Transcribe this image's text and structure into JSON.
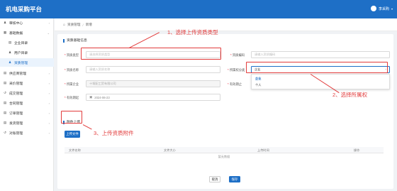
{
  "header": {
    "app_title": "机电采购平台",
    "user_name": "李采购",
    "caret": "▾"
  },
  "sidebar": {
    "items": [
      {
        "icon": "user-icon",
        "glyph": "♟",
        "label": "审核中心",
        "arrow": "›"
      },
      {
        "icon": "database-icon",
        "glyph": "▦",
        "label": "基础数据",
        "arrow": "⌄"
      },
      {
        "icon": "building-icon",
        "glyph": "▤",
        "label": "企业目录"
      },
      {
        "icon": "users-icon",
        "glyph": "♟",
        "label": "用户目录"
      },
      {
        "icon": "qualification-icon",
        "glyph": "♟",
        "label": "资质管理"
      },
      {
        "icon": "supplier-icon",
        "glyph": "▤",
        "label": "供应商管理",
        "arrow": "›"
      },
      {
        "icon": "inquiry-icon",
        "glyph": "▤",
        "label": "采价管理",
        "arrow": "›"
      },
      {
        "icon": "deal-icon",
        "glyph": "↺",
        "label": "成交管理",
        "arrow": "›"
      },
      {
        "icon": "contract-icon",
        "glyph": "▤",
        "label": "合同管理",
        "arrow": "›"
      },
      {
        "icon": "order-icon",
        "glyph": "▤",
        "label": "订单管理",
        "arrow": "›"
      },
      {
        "icon": "shipping-icon",
        "glyph": "▤",
        "label": "发货管理",
        "arrow": "›"
      },
      {
        "icon": "reconcile-icon",
        "glyph": "↺",
        "label": "对账管理",
        "arrow": "›"
      }
    ]
  },
  "breadcrumb": {
    "home_glyph": "⌂",
    "items": [
      "资质管理",
      "新增"
    ],
    "sep": "/"
  },
  "form": {
    "section_title": "资质基础信息",
    "fields": {
      "qual_type": {
        "label": "资质类型",
        "placeholder": "请选择资质类型"
      },
      "qual_code": {
        "label": "资质编码",
        "placeholder": "请输入资质编码"
      },
      "qual_name": {
        "label": "资质名称",
        "placeholder": "请输入资质名称"
      },
      "ownership": {
        "label": "所属权分类",
        "value": "企业"
      },
      "company": {
        "label": "所属企业",
        "value": "十堰配工贸有限公司"
      },
      "expiry": {
        "label": "有效期止",
        "value": ""
      },
      "issue_date": {
        "label": "有效期起",
        "value": "2024-06-23"
      }
    },
    "ownership_options": [
      "企业",
      "个人"
    ]
  },
  "attachments": {
    "section_title": "附件上传",
    "upload_button": "上传文件",
    "columns": [
      "文件名称",
      "文件大小",
      "上传时间",
      "操作"
    ],
    "empty_text": "暂无数据"
  },
  "footer": {
    "cancel": "取消",
    "save": "保存"
  },
  "annotations": {
    "step1": "1、选择上传资质类型",
    "step2": "2、选择所属权",
    "step3": "3、上传资质附件",
    "color": "#e23b3b"
  }
}
